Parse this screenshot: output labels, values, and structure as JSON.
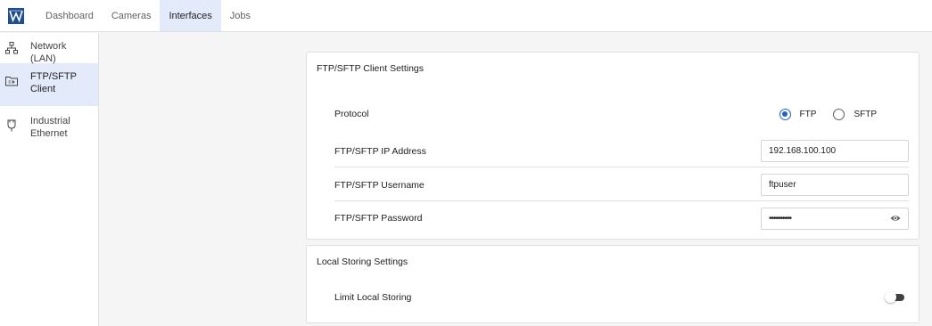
{
  "header": {
    "logo_icon": "brand-logo-icon",
    "tabs": [
      {
        "label": "Dashboard",
        "active": false
      },
      {
        "label": "Cameras",
        "active": false
      },
      {
        "label": "Interfaces",
        "active": true
      },
      {
        "label": "Jobs",
        "active": false
      }
    ]
  },
  "sidebar": {
    "items": [
      {
        "label": "Network (LAN)",
        "icon": "network-icon",
        "active": false
      },
      {
        "label": "FTP/SFTP Client",
        "icon": "folder-icon",
        "active": true
      },
      {
        "label": "Industrial Ethernet",
        "icon": "plug-icon",
        "active": false
      }
    ]
  },
  "ftp_card": {
    "title": "FTP/SFTP Client Settings",
    "protocol": {
      "label": "Protocol",
      "options": [
        "FTP",
        "SFTP"
      ],
      "selected": "FTP"
    },
    "ip": {
      "label": "FTP/SFTP IP Address",
      "value": "192.168.100.100"
    },
    "username": {
      "label": "FTP/SFTP Username",
      "value": "ftpuser"
    },
    "password": {
      "label": "FTP/SFTP Password",
      "value": "••••••••••",
      "icon": "eye-icon"
    }
  },
  "local_card": {
    "title": "Local Storing Settings",
    "limit": {
      "label": "Limit Local Storing",
      "enabled": false
    }
  },
  "colors": {
    "accent": "#1e5fd8",
    "active_bg": "#e3ebfa"
  }
}
